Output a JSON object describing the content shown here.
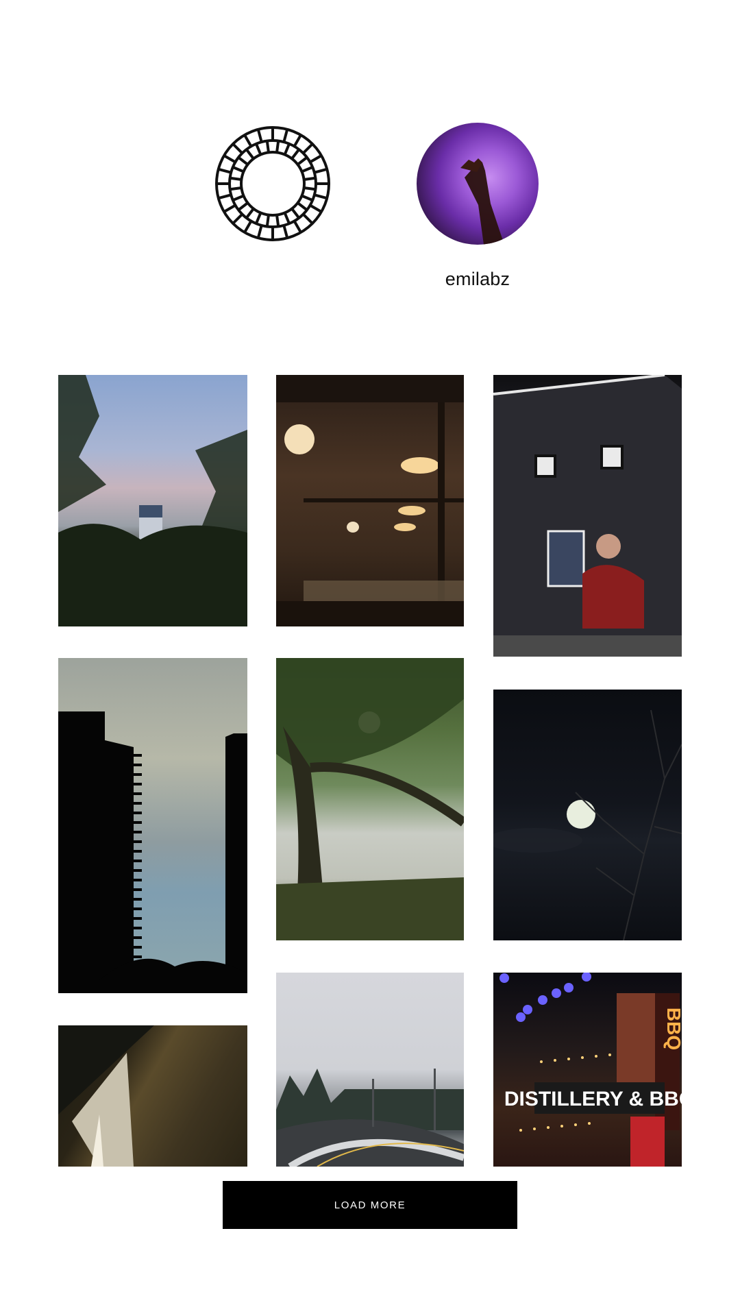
{
  "profile": {
    "username": "emilabz",
    "logo_icon": "vsco-logo-icon",
    "avatar_icon": "profile-avatar"
  },
  "gallery": {
    "images": [
      {
        "name": "tree-silhouette-water-tower"
      },
      {
        "name": "restaurant-interior-lamps"
      },
      {
        "name": "building-mural"
      },
      {
        "name": "tower-silhouettes-sky"
      },
      {
        "name": "tree-over-river-sunlight"
      },
      {
        "name": "full-moon-night-branches"
      },
      {
        "name": "abstract-light-wall"
      },
      {
        "name": "snowy-road"
      },
      {
        "name": "distillery-neon-signs"
      }
    ],
    "distillery_sign": "DISTILLERY & BBQ",
    "neon_bbq": "BBQ"
  },
  "actions": {
    "load_more_label": "LOAD MORE"
  },
  "colors": {
    "background": "#ffffff",
    "button_bg": "#000000",
    "button_text": "#ffffff",
    "username_text": "#111111"
  }
}
